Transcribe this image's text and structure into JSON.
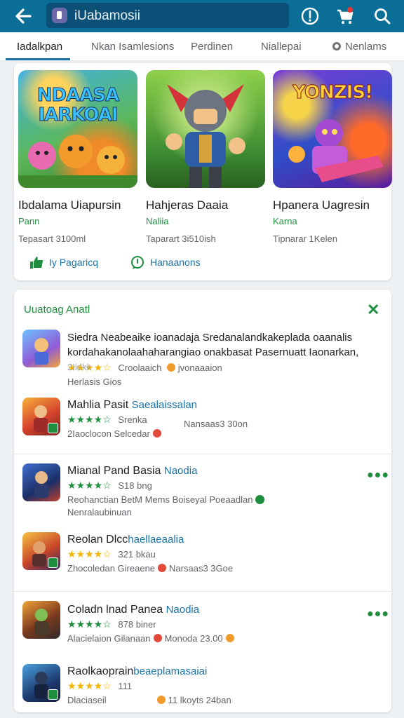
{
  "appbar": {
    "search_value": "iUabamosii",
    "icons": [
      "back-arrow-icon",
      "store-icon",
      "compass-icon",
      "cart-icon",
      "search-icon"
    ],
    "cart_badge_color": "#e53935"
  },
  "tabs": [
    {
      "label": "Iadalkpan",
      "active": true
    },
    {
      "label": "Nkan Isamlesions",
      "active": false
    },
    {
      "label": "Perdinen",
      "active": false
    },
    {
      "label": "Niallepai",
      "active": false
    },
    {
      "label": "Nenlams",
      "active": false
    }
  ],
  "featured": {
    "items": [
      {
        "art_text": "NDAASA IARKOAI",
        "title": "Ibdalama Uiapursin",
        "subtitle": "Pann",
        "meta": "Tepasart 3100ml"
      },
      {
        "art_text": "",
        "title": "Hahjeras Daaia",
        "subtitle": "Naliia",
        "meta": "Taparart 3i510ish"
      },
      {
        "art_text": "YONZIS!",
        "title": "Hpanera Uagresin",
        "subtitle": "Karna",
        "meta": "Tipnarar 1Kelen"
      }
    ],
    "actions": [
      {
        "label": "Iy Pagaricq",
        "icon": "thumbs-up-icon"
      },
      {
        "label": "Hanaanons",
        "icon": "chat-icon"
      }
    ]
  },
  "list": {
    "title": "Uuatoag Anatl",
    "close_icon": "close-icon",
    "rows": [
      {
        "title": "Siedra Neabeaike ioanadaja Sredanalandkakeplada oaanalis kordahakanolaahaharangiao onakbasat Pasernuatt Iaonarkan,",
        "developer": "",
        "rating_text": "2Iidkk",
        "line1": "Croolaaich",
        "line1b": "jvonaaaion",
        "line2": "Herlasis Gios"
      },
      {
        "title": "Mahlia Pasit",
        "developer": "Saealaissalan",
        "rating_text": "Srenka",
        "line1b": "Nansaas3 30on",
        "line2": "2Iaoclocon Selcedar"
      },
      {
        "title": "Mianal Pand Basia",
        "developer": "Naodia",
        "rating_text": "S18 bng",
        "line2": "Reohanctian BetM Mems Boiseyal Poeaadlan",
        "line3": "Nenralaubinuan"
      },
      {
        "title": "Reolan Dlcc",
        "developer": "haellaeaalia",
        "rating_text": "321 bkau",
        "line2": "Zhocoledan Gireaene",
        "line2b": "Narsaas3 3Goe"
      },
      {
        "title": "Coladn lnad Panea",
        "developer": "Naodia",
        "rating_text": "878 biner",
        "line2": "Alacielaion Gilanaan",
        "line2b": "Monoda 23.00"
      },
      {
        "title": "Raolkaoprain",
        "developer": "beaeplamasaiai",
        "rating_text": "111",
        "line2": "Dlaciaseil",
        "line2b": "11 lkoyts 24ban"
      }
    ]
  }
}
